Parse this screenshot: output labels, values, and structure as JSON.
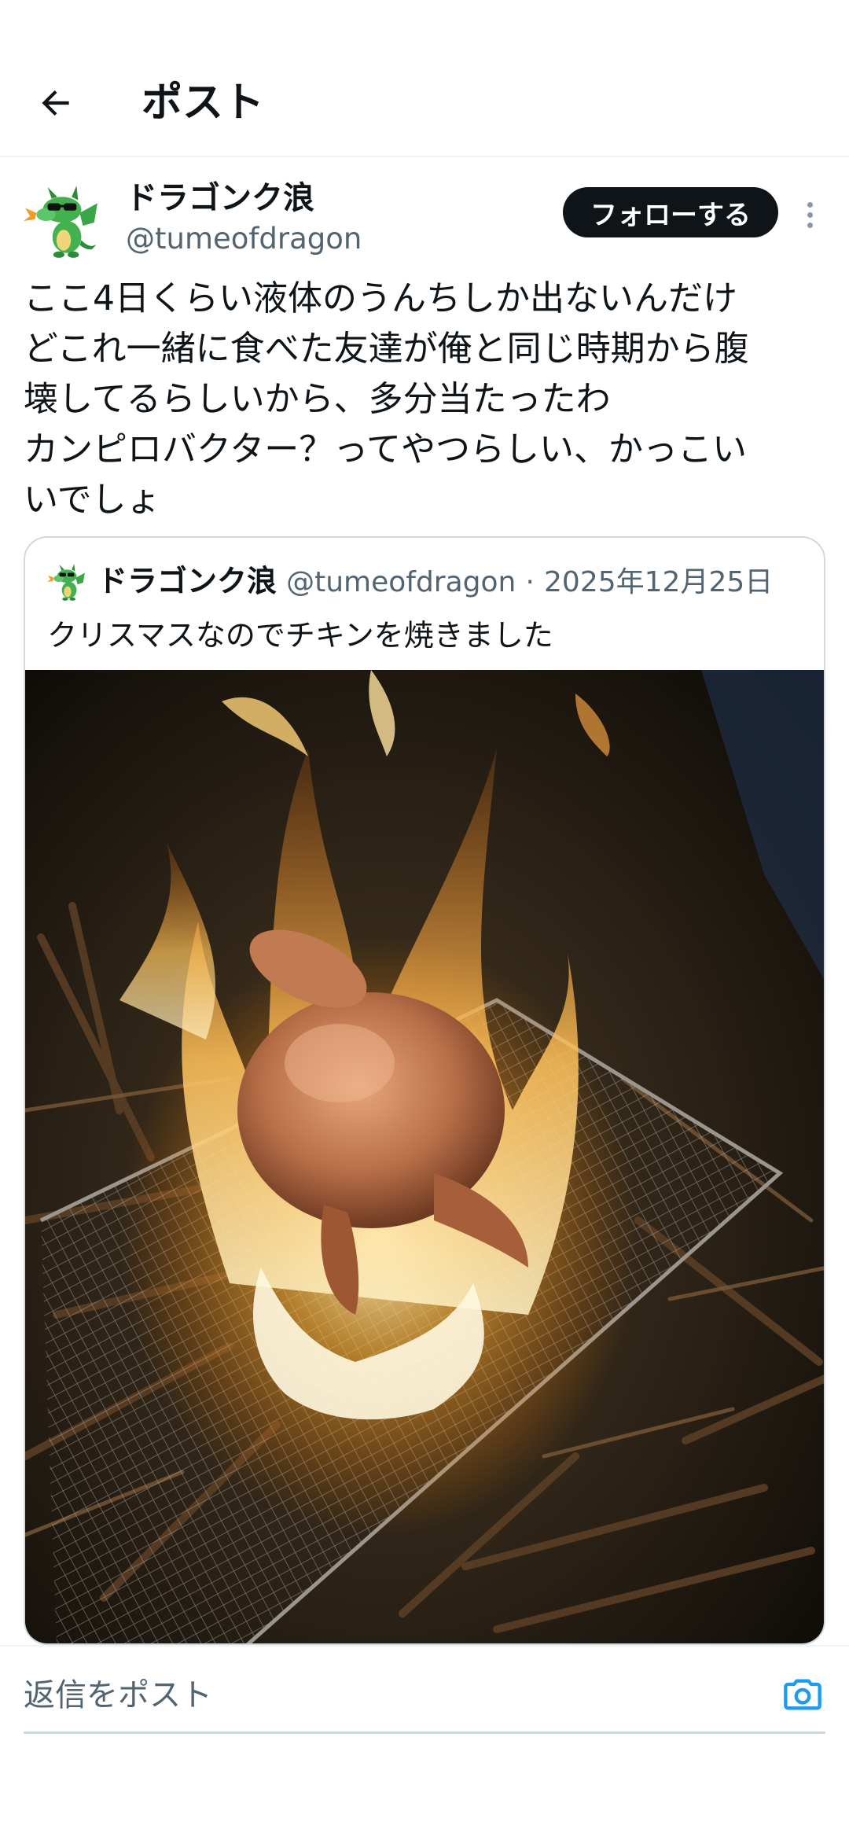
{
  "header": {
    "title": "ポスト",
    "back_icon": "arrow-left-icon"
  },
  "post": {
    "author": {
      "display_name": "ドラゴンク浪",
      "handle": "@tumeofdragon",
      "avatar": "dragon-with-sunglasses-avatar"
    },
    "follow_label": "フォローする",
    "more_icon": "vertical-dots-icon",
    "text_lines": [
      "ここ4日くらい液体のうんちしか出ないんだけ",
      "どこれ一緒に食べた友達が俺と同じ時期から腹",
      "壊してるらしいから、多分当たったわ",
      "カンピロバクター？ってやつらしい、かっこい",
      "いでしょ"
    ]
  },
  "quote": {
    "display_name": "ドラゴンク浪",
    "handle": "@tumeofdragon",
    "separator": "·",
    "date": "2025年12月25日",
    "text": "クリスマスなのでチキンを焼きました",
    "media": "photo-whole-chicken-roasting-on-grill-over-campfire"
  },
  "reply": {
    "placeholder": "返信をポスト",
    "camera_icon": "camera-icon"
  },
  "colors": {
    "text_primary": "#0f1419",
    "text_secondary": "#536471",
    "border": "#cfd9de",
    "accent": "#1d9bf0",
    "follow_bg": "#0f1419"
  }
}
